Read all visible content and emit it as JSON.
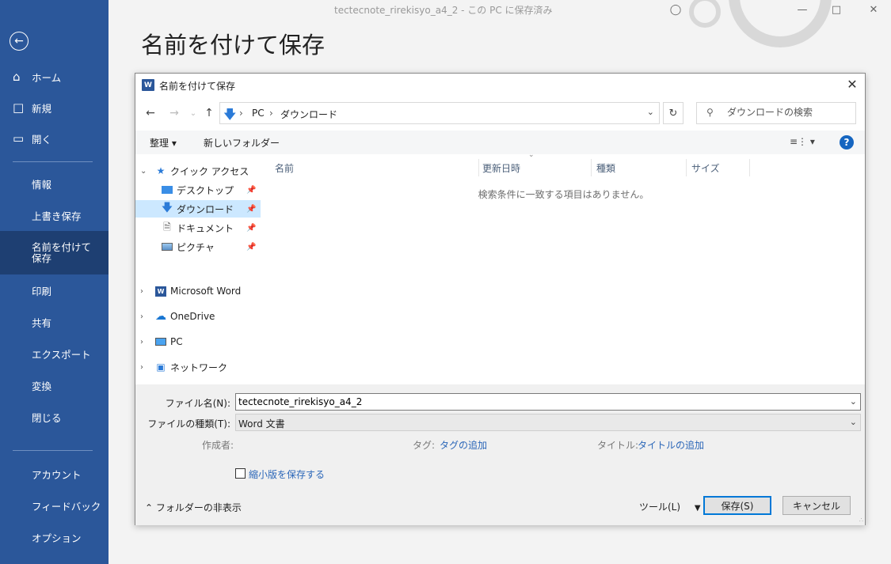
{
  "window": {
    "title": "tectecnote_rirekisyo_a4_2 - この PC に保存済み"
  },
  "page_title": "名前を付けて保存",
  "sidebar": {
    "items": [
      {
        "label": "ホーム",
        "icon": "home-icon"
      },
      {
        "label": "新規",
        "icon": "new-document-icon"
      },
      {
        "label": "開く",
        "icon": "open-folder-icon"
      },
      {
        "label": "情報"
      },
      {
        "label": "上書き保存"
      },
      {
        "label": "名前を付けて保存"
      },
      {
        "label": "印刷"
      },
      {
        "label": "共有"
      },
      {
        "label": "エクスポート"
      },
      {
        "label": "変換"
      },
      {
        "label": "閉じる"
      },
      {
        "label": "アカウント"
      },
      {
        "label": "フィードバック"
      },
      {
        "label": "オプション"
      }
    ],
    "active": "名前を付けて保存"
  },
  "dialog": {
    "title": "名前を付けて保存",
    "address": {
      "part1": "PC",
      "part2": "ダウンロード"
    },
    "search_placeholder": "ダウンロードの検索",
    "toolbar": {
      "organize": "整理 ▾",
      "new_folder": "新しいフォルダー"
    },
    "nav": {
      "quick_access": "クイック アクセス",
      "desktop": "デスクトップ",
      "downloads": "ダウンロード",
      "documents": "ドキュメント",
      "pictures": "ピクチャ",
      "word": "Microsoft Word",
      "onedrive": "OneDrive",
      "pc": "PC",
      "network": "ネットワーク"
    },
    "columns": {
      "name": "名前",
      "date": "更新日時",
      "type": "種類",
      "size": "サイズ"
    },
    "empty_message": "検索条件に一致する項目はありません。",
    "file_name_label": "ファイル名(N):",
    "file_name_value": "tectecnote_rirekisyo_a4_2",
    "file_type_label": "ファイルの種類(T):",
    "file_type_value": "Word 文書",
    "authors_label": "作成者:",
    "tags_label": "タグ:",
    "tags_link": "タグの追加",
    "title_label": "タイトル:",
    "title_link": "タイトルの追加",
    "thumbnail_label": "縮小版を保存する",
    "hide_folders": "フォルダーの非表示",
    "tools": "ツール(L)",
    "save": "保存(S)",
    "cancel": "キャンセル"
  },
  "colors": {
    "accent": "#2b579a",
    "sidebar_active": "#1e3f72",
    "selection": "#cce8ff",
    "link": "#2a66b8"
  }
}
